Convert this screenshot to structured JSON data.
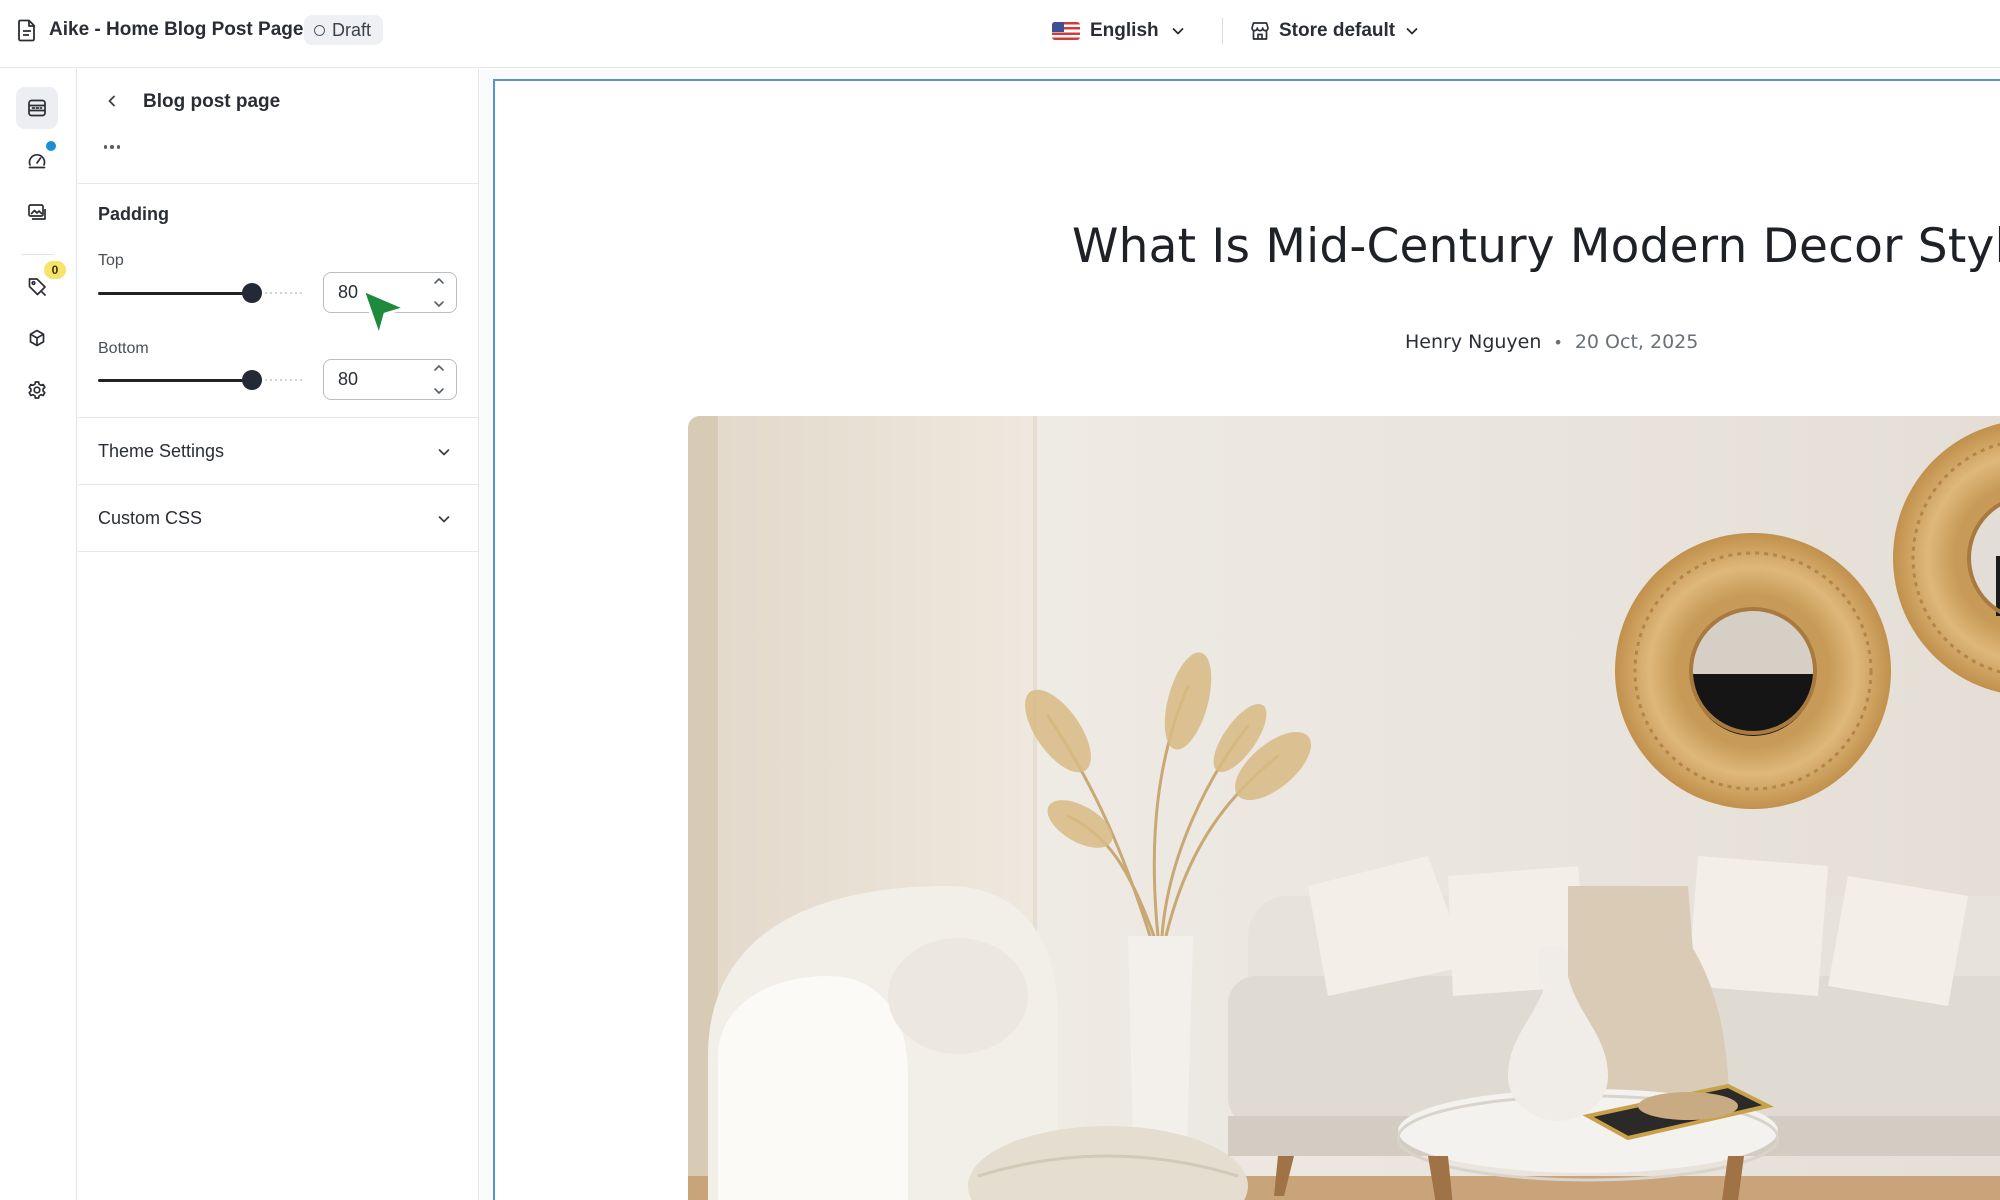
{
  "topbar": {
    "page_title": "Aike - Home Blog Post Page",
    "status": "Draft",
    "language": "English",
    "store": "Store default"
  },
  "rail": {
    "discount_badge_count": "0"
  },
  "panel": {
    "title": "Blog post page",
    "padding": {
      "title": "Padding",
      "top_label": "Top",
      "top_value": "80",
      "bottom_label": "Bottom",
      "bottom_value": "80"
    },
    "theme_settings_label": "Theme Settings",
    "custom_css_label": "Custom CSS"
  },
  "preview": {
    "post_title": "What Is Mid-Century Modern Decor Style?",
    "author": "Henry Nguyen",
    "separator": "•",
    "date": "20 Oct, 2025"
  },
  "colors": {
    "accent_blue": "#5b8fd6",
    "notification_dot": "#1b8fd6",
    "badge_yellow": "#f6e46a",
    "cursor_green": "#1e8a3c"
  }
}
